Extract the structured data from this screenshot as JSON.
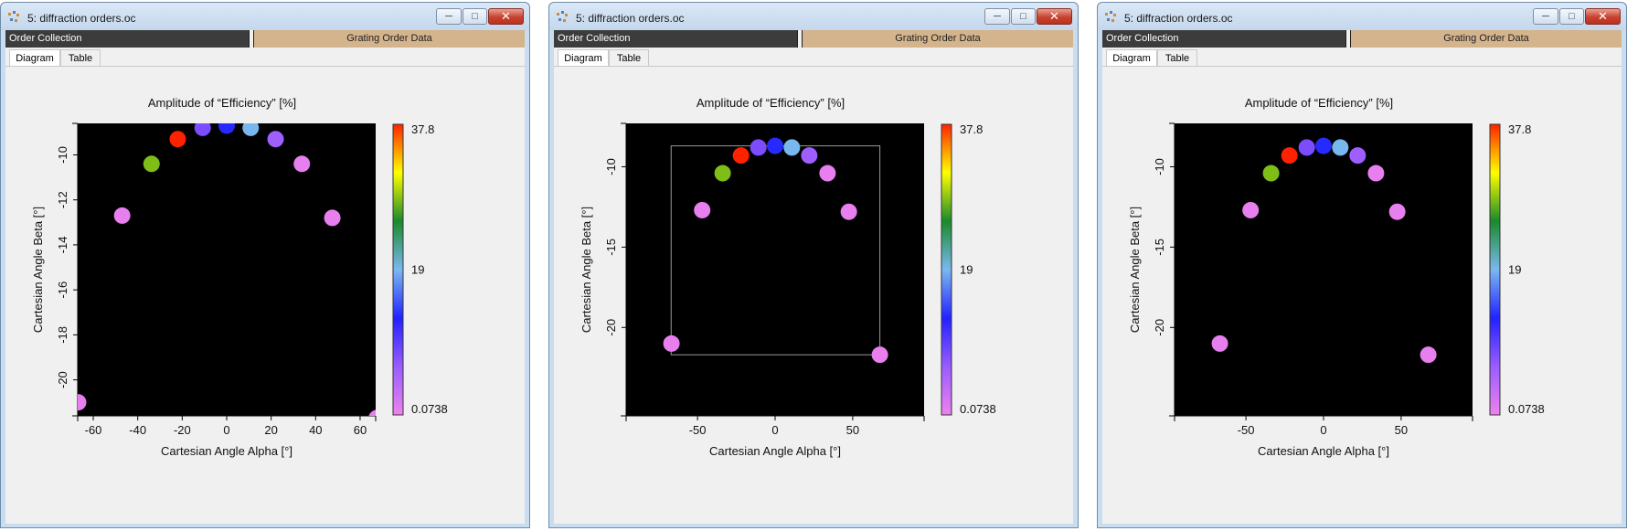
{
  "windows": [
    {
      "title": "5: diffraction orders.oc",
      "nav_left": "Order Collection",
      "nav_right": "Grating Order Data",
      "tabs": [
        "Diagram",
        "Table"
      ],
      "chart_data": {
        "type": "scatter",
        "title": "Amplitude of “Efficiency”  [%]",
        "xlabel": "Cartesian Angle Alpha [°]",
        "ylabel": "Cartesian Angle Beta [°]",
        "xlim": [
          -67,
          67
        ],
        "ylim": [
          -21.6,
          -8.6
        ],
        "xticks": [
          -60,
          -40,
          -20,
          0,
          20,
          40,
          60
        ],
        "yticks": [
          -10,
          -12,
          -14,
          -16,
          -18,
          -20
        ],
        "colorbar": {
          "min_label": "0.0738",
          "mid_label": "19",
          "max_label": "37.8",
          "min": 0.0738,
          "max": 37.8
        },
        "background": "#000000",
        "bounding_box": false,
        "points": [
          {
            "x": -66.8,
            "y": -21.0,
            "value": 0.5
          },
          {
            "x": -47.0,
            "y": -12.7,
            "value": 0.6
          },
          {
            "x": -33.8,
            "y": -10.4,
            "value": 28.0
          },
          {
            "x": -22.0,
            "y": -9.3,
            "value": 37.8
          },
          {
            "x": -10.8,
            "y": -8.8,
            "value": 8.0
          },
          {
            "x": 0.0,
            "y": -8.7,
            "value": 13.0
          },
          {
            "x": 10.8,
            "y": -8.8,
            "value": 19.0
          },
          {
            "x": 22.0,
            "y": -9.3,
            "value": 6.0
          },
          {
            "x": 33.8,
            "y": -10.4,
            "value": 0.6
          },
          {
            "x": 47.5,
            "y": -12.8,
            "value": 0.5
          },
          {
            "x": 67.5,
            "y": -21.7,
            "value": 0.5
          }
        ]
      }
    },
    {
      "title": "5: diffraction orders.oc",
      "nav_left": "Order Collection",
      "nav_right": "Grating Order Data",
      "tabs": [
        "Diagram",
        "Table"
      ],
      "chart_data": {
        "type": "scatter",
        "title": "Amplitude of “Efficiency”  [%]",
        "xlabel": "Cartesian Angle Alpha [°]",
        "ylabel": "Cartesian Angle Beta [°]",
        "xlim": [
          -96,
          96
        ],
        "ylim": [
          -25.5,
          -7.3
        ],
        "xticks": [
          -50,
          0,
          50
        ],
        "yticks": [
          -10,
          -15,
          -20
        ],
        "colorbar": {
          "min_label": "0.0738",
          "mid_label": "19",
          "max_label": "37.8",
          "min": 0.0738,
          "max": 37.8
        },
        "background": "#000000",
        "bounding_box": true,
        "box": {
          "x": [
            -67,
            67.5
          ],
          "y": [
            -21.7,
            -8.7
          ]
        },
        "points": [
          {
            "x": -66.8,
            "y": -21.0,
            "value": 0.5
          },
          {
            "x": -47.0,
            "y": -12.7,
            "value": 0.6
          },
          {
            "x": -33.8,
            "y": -10.4,
            "value": 28.0
          },
          {
            "x": -22.0,
            "y": -9.3,
            "value": 37.8
          },
          {
            "x": -10.8,
            "y": -8.8,
            "value": 8.0
          },
          {
            "x": 0.0,
            "y": -8.7,
            "value": 13.0
          },
          {
            "x": 10.8,
            "y": -8.8,
            "value": 19.0
          },
          {
            "x": 22.0,
            "y": -9.3,
            "value": 6.0
          },
          {
            "x": 33.8,
            "y": -10.4,
            "value": 0.6
          },
          {
            "x": 47.5,
            "y": -12.8,
            "value": 0.5
          },
          {
            "x": 67.5,
            "y": -21.7,
            "value": 0.5
          }
        ]
      }
    },
    {
      "title": "5: diffraction orders.oc",
      "nav_left": "Order Collection",
      "nav_right": "Grating Order Data",
      "tabs": [
        "Diagram",
        "Table"
      ],
      "chart_data": {
        "type": "scatter",
        "title": "Amplitude of “Efficiency”  [%]",
        "xlabel": "Cartesian Angle Alpha [°]",
        "ylabel": "Cartesian Angle Beta [°]",
        "xlim": [
          -96,
          96
        ],
        "ylim": [
          -25.5,
          -7.3
        ],
        "xticks": [
          -50,
          0,
          50
        ],
        "yticks": [
          -10,
          -15,
          -20
        ],
        "colorbar": {
          "min_label": "0.0738",
          "mid_label": "19",
          "max_label": "37.8",
          "min": 0.0738,
          "max": 37.8
        },
        "background": "#000000",
        "bounding_box": false,
        "points": [
          {
            "x": -66.8,
            "y": -21.0,
            "value": 0.5
          },
          {
            "x": -47.0,
            "y": -12.7,
            "value": 0.6
          },
          {
            "x": -33.8,
            "y": -10.4,
            "value": 28.0
          },
          {
            "x": -22.0,
            "y": -9.3,
            "value": 37.8
          },
          {
            "x": -10.8,
            "y": -8.8,
            "value": 8.0
          },
          {
            "x": 0.0,
            "y": -8.7,
            "value": 13.0
          },
          {
            "x": 10.8,
            "y": -8.8,
            "value": 19.0
          },
          {
            "x": 22.0,
            "y": -9.3,
            "value": 6.0
          },
          {
            "x": 33.8,
            "y": -10.4,
            "value": 0.6
          },
          {
            "x": 47.5,
            "y": -12.8,
            "value": 0.5
          },
          {
            "x": 67.5,
            "y": -21.7,
            "value": 0.5
          }
        ]
      }
    }
  ],
  "colormap": [
    "#ee82ee",
    "#9a5cff",
    "#2222ff",
    "#7ab8f0",
    "#1a8a2a",
    "#ffff00",
    "#ff2200"
  ]
}
